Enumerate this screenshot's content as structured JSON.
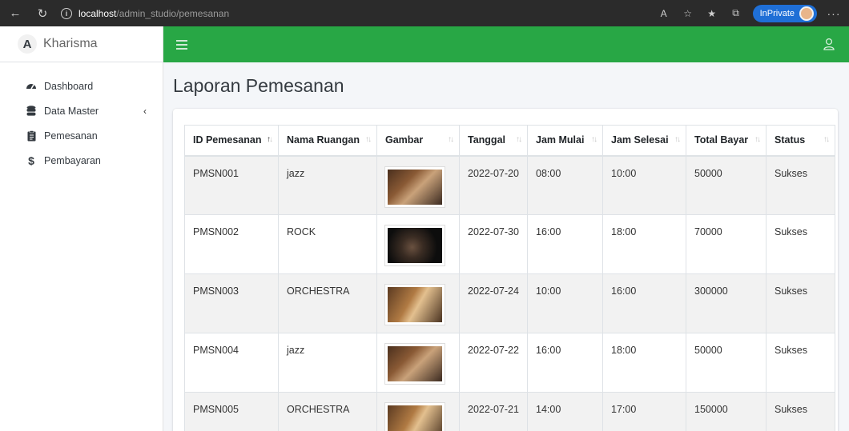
{
  "browser": {
    "url_host": "localhost",
    "url_path": "/admin_studio/pemesanan",
    "inprivate_label": "InPrivate"
  },
  "brand": {
    "logo_letter": "A",
    "name": "Kharisma"
  },
  "sidebar": {
    "items": [
      {
        "label": "Dashboard",
        "icon": "dashboard-icon"
      },
      {
        "label": "Data Master",
        "icon": "database-icon",
        "chevron": "‹"
      },
      {
        "label": "Pemesanan",
        "icon": "clipboard-icon"
      },
      {
        "label": "Pembayaran",
        "icon": "dollar-icon"
      }
    ]
  },
  "page": {
    "title": "Laporan Pemesanan"
  },
  "table": {
    "headers": [
      "ID Pemesanan",
      "Nama Ruangan",
      "Gambar",
      "Tanggal",
      "Jam Mulai",
      "Jam Selesai",
      "Total Bayar",
      "Status"
    ],
    "rows": [
      {
        "id": "PMSN001",
        "ruangan": "jazz",
        "image": "studio-photo-jazz",
        "tanggal": "2022-07-20",
        "mulai": "08:00",
        "selesai": "10:00",
        "total": "50000",
        "status": "Sukses"
      },
      {
        "id": "PMSN002",
        "ruangan": "ROCK",
        "image": "studio-photo-rock",
        "tanggal": "2022-07-30",
        "mulai": "16:00",
        "selesai": "18:00",
        "total": "70000",
        "status": "Sukses"
      },
      {
        "id": "PMSN003",
        "ruangan": "ORCHESTRA",
        "image": "studio-photo-orchestra",
        "tanggal": "2022-07-24",
        "mulai": "10:00",
        "selesai": "16:00",
        "total": "300000",
        "status": "Sukses"
      },
      {
        "id": "PMSN004",
        "ruangan": "jazz",
        "image": "studio-photo-jazz",
        "tanggal": "2022-07-22",
        "mulai": "16:00",
        "selesai": "18:00",
        "total": "50000",
        "status": "Sukses"
      },
      {
        "id": "PMSN005",
        "ruangan": "ORCHESTRA",
        "image": "studio-photo-orchestra",
        "tanggal": "2022-07-21",
        "mulai": "14:00",
        "selesai": "17:00",
        "total": "150000",
        "status": "Sukses"
      }
    ]
  },
  "colors": {
    "topbar": "#28a745",
    "inprivate": "#1f6fd6"
  }
}
